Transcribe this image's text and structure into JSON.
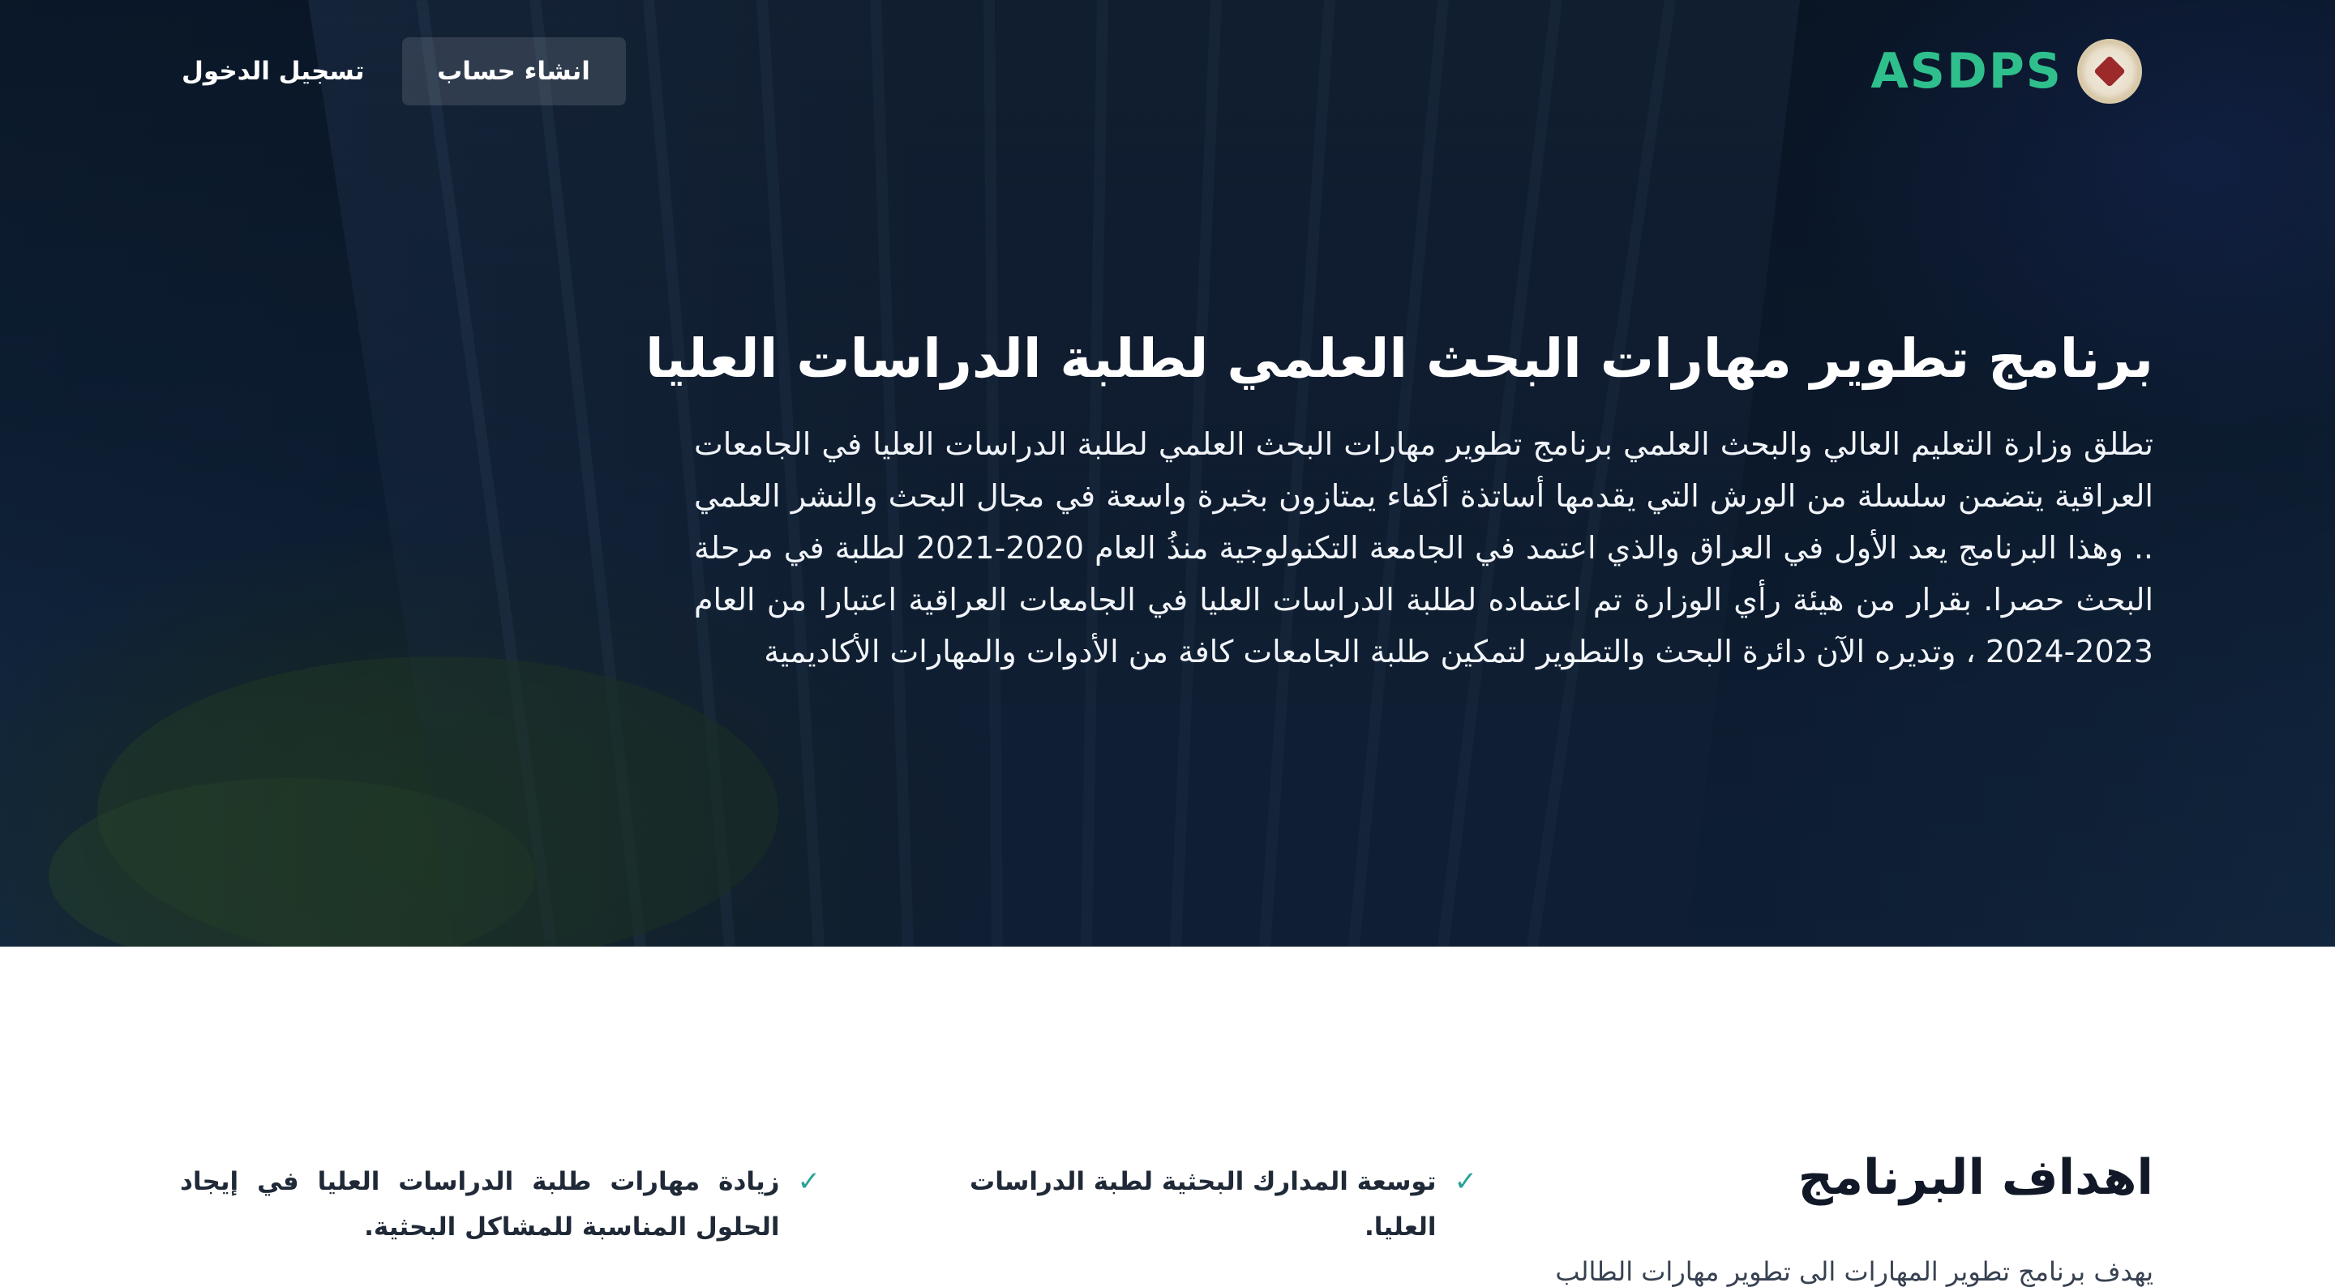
{
  "nav": {
    "logo_text": "ASDPS",
    "login_label": "تسجيل الدخول",
    "register_label": "انشاء حساب"
  },
  "hero": {
    "title": "برنامج تطوير مهارات البحث العلمي لطلبة الدراسات العليا",
    "description": "تطلق وزارة التعليم العالي والبحث العلمي برنامج تطوير مهارات البحث العلمي لطلبة الدراسات العليا في الجامعات العراقية يتضمن سلسلة من الورش التي يقدمها أساتذة أكفاء يمتازون بخبرة واسعة في مجال البحث والنشر العلمي .. وهذا البرنامج يعد الأول في العراق والذي اعتمد في الجامعة التكنولوجية منذُ العام 2020-2021 لطلبة في مرحلة البحث حصرا. بقرار من هيئة رأي الوزارة تم اعتماده لطلبة الدراسات العليا في الجامعات العراقية اعتبارا من العام 2023-2024 ، وتديره الآن دائرة البحث والتطوير لتمكين طلبة الجامعات كافة من الأدوات والمهارات الأكاديمية"
  },
  "goals": {
    "title": "اهداف البرنامج",
    "intro": "يهدف برنامج تطوير المهارات الى تطوير مهارات الطالب",
    "check_icon": "✓",
    "items": [
      {
        "text": "توسعة المدارك البحثية لطبة الدراسات العليا."
      },
      {
        "text": "زيادة مهارات طلبة الدراسات العليا في إيجاد الحلول المناسبة للمشاكل البحثية."
      }
    ]
  },
  "colors": {
    "logo_green": "#2fbf8c",
    "check_teal": "#2ea39a",
    "hero_navy": "#0f2238"
  }
}
